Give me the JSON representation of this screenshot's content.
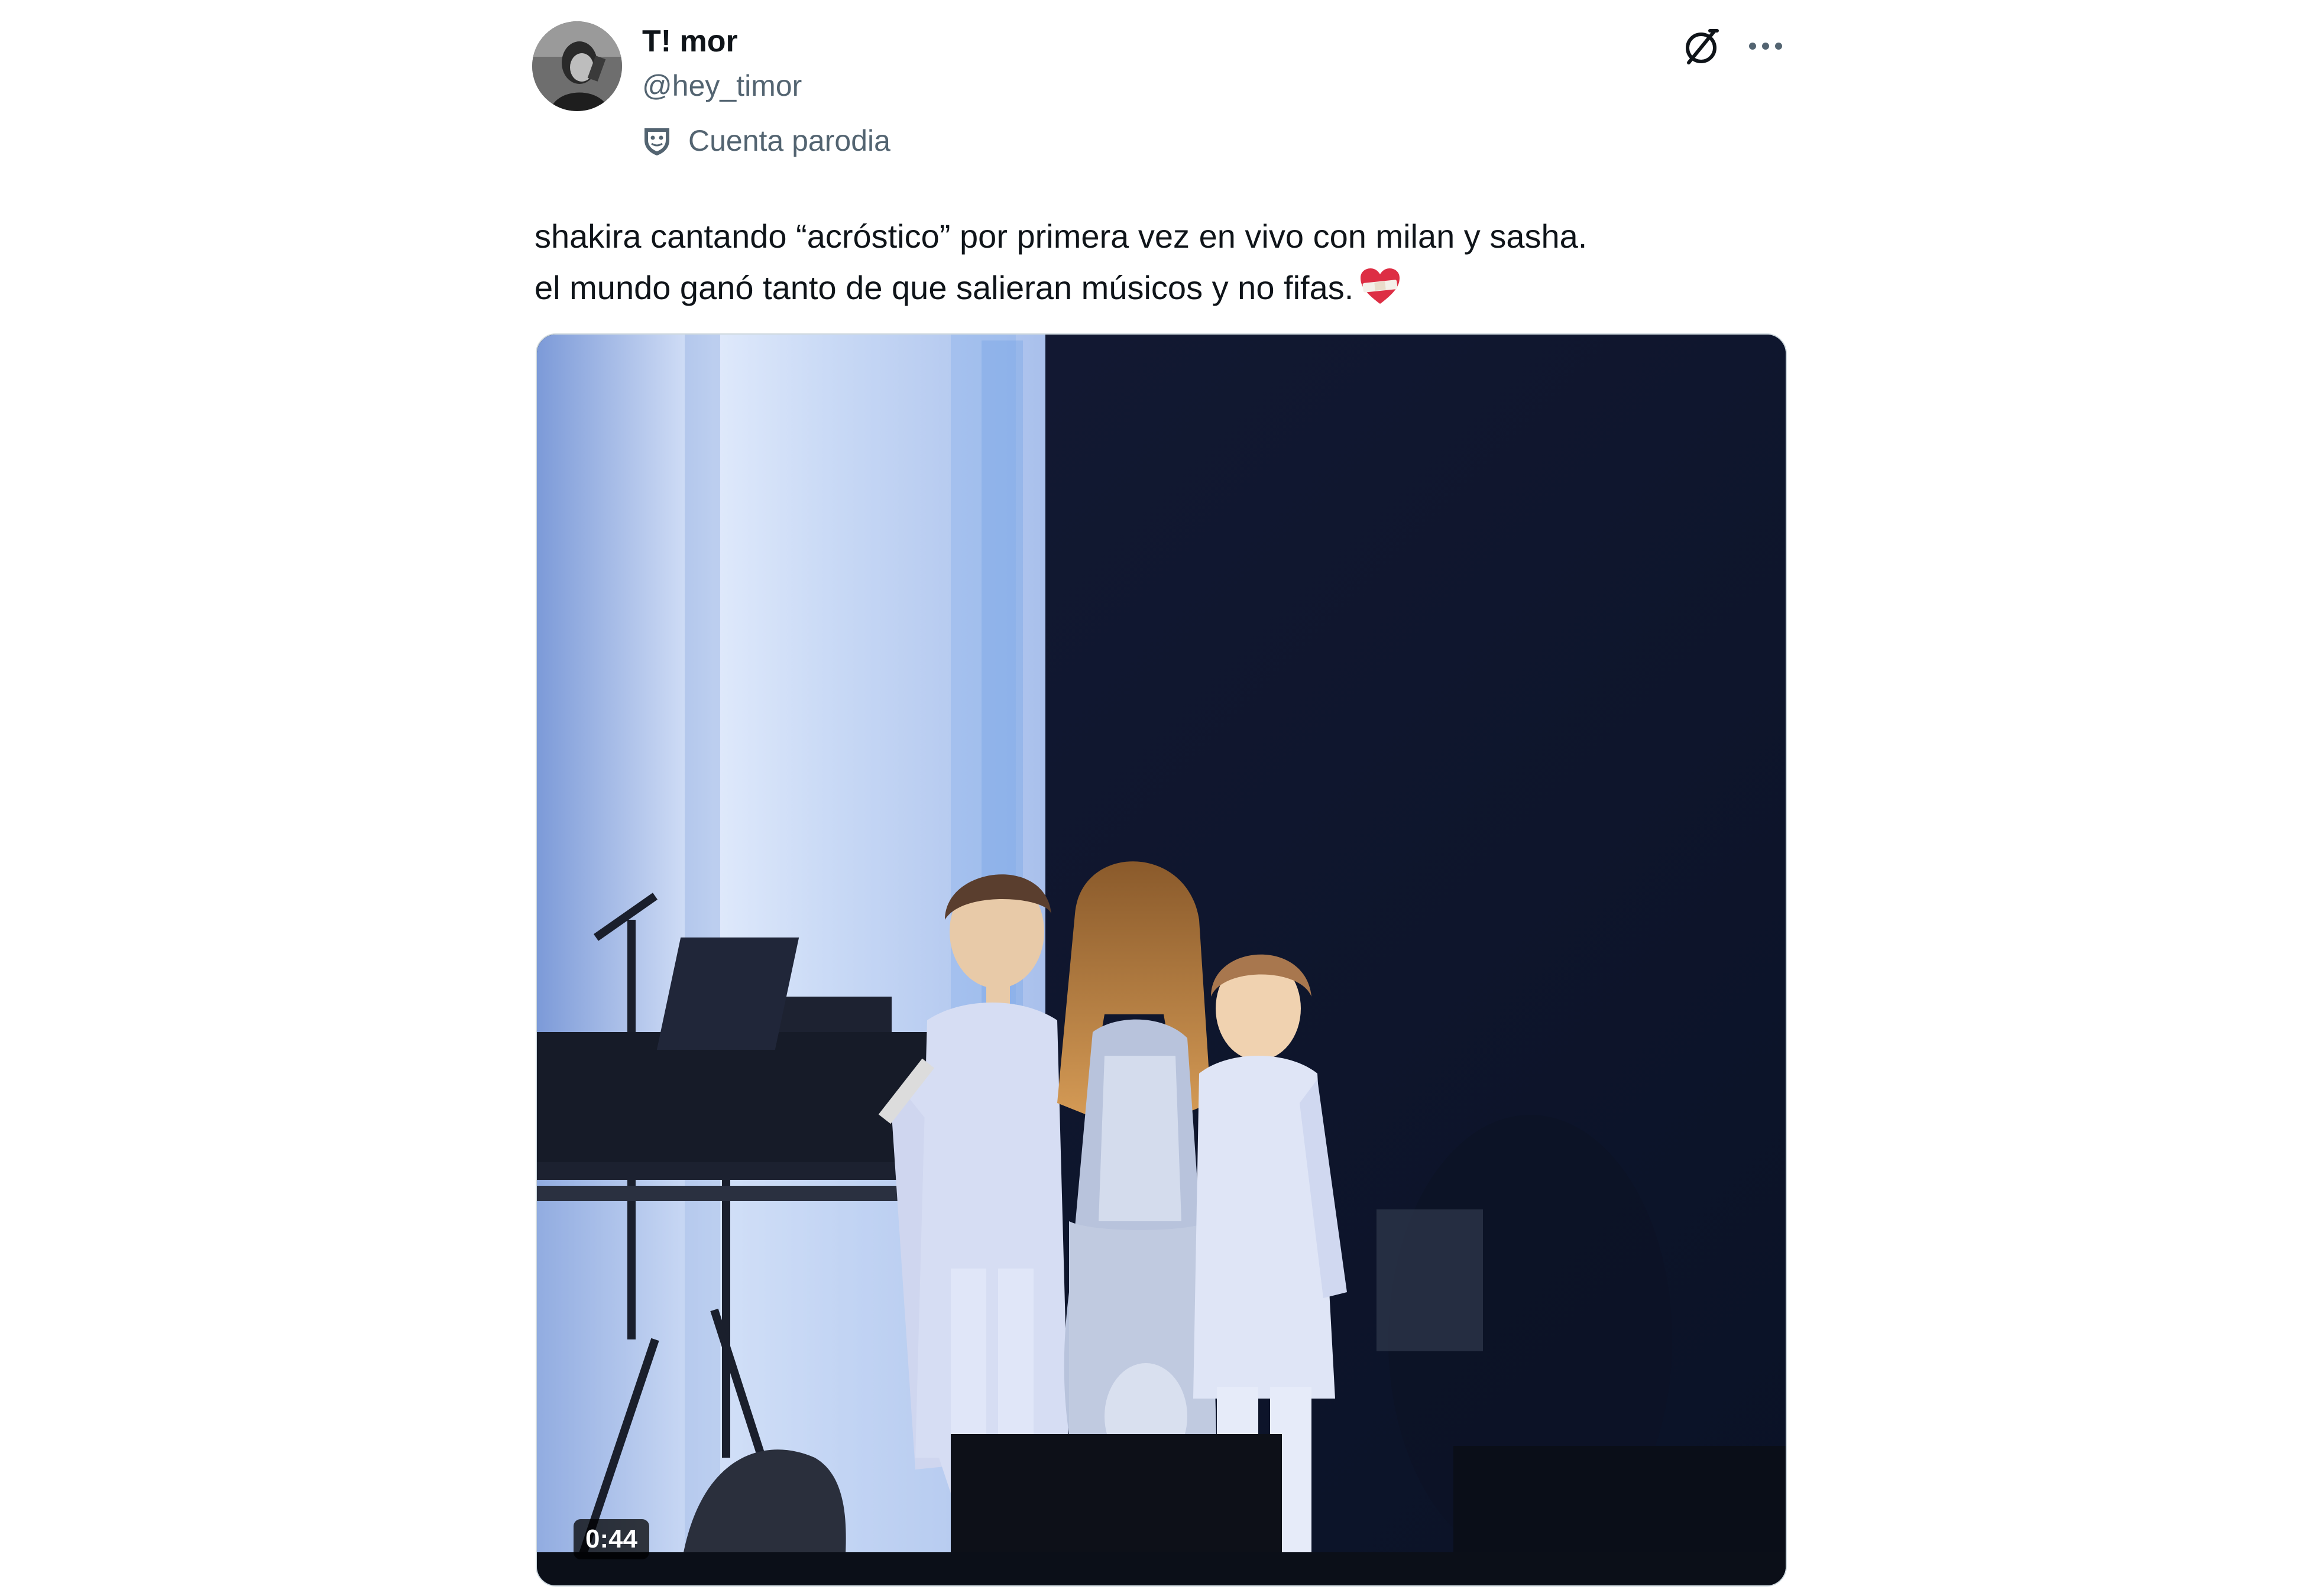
{
  "author": {
    "display_name": "T! mor",
    "handle": "@hey_timor",
    "label": "Cuenta parodia",
    "avatar_icon": "avatar-photo"
  },
  "header_actions": {
    "grok_icon": "grok-slashed-circle-icon",
    "more_icon": "ellipsis-icon"
  },
  "tweet": {
    "text_line_1": "shakira cantando “acróstico” por primera vez en vivo con milan  y sasha.",
    "text_line_2": "el mundo ganó tanto de que salieran músicos y no fifas.",
    "emoji": "heart-with-bandage"
  },
  "media": {
    "type": "video",
    "duration": "0:44"
  },
  "colors": {
    "text_primary": "#0f1419",
    "text_secondary": "#536471",
    "border": "#cfd9de"
  }
}
